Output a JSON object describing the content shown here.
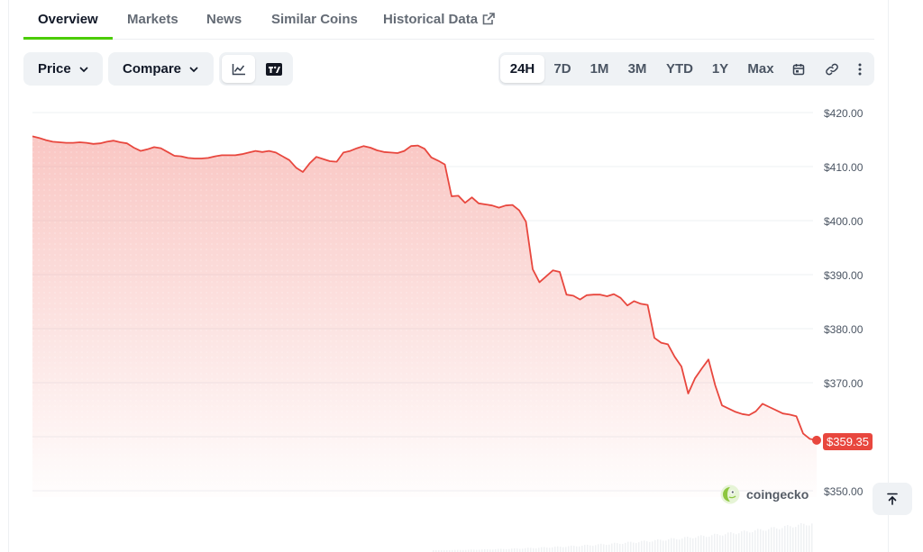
{
  "tabs": [
    {
      "label": "Overview",
      "active": true
    },
    {
      "label": "Markets"
    },
    {
      "label": "News"
    },
    {
      "label": "Similar Coins"
    },
    {
      "label": "Historical Data",
      "icon": "external-link-icon"
    }
  ],
  "toolbar": {
    "price_label": "Price",
    "compare_label": "Compare",
    "chart_types": [
      {
        "icon": "line-chart-icon",
        "selected": true
      },
      {
        "icon": "tradingview-icon",
        "selected": false
      }
    ],
    "ranges": [
      "24H",
      "7D",
      "1M",
      "3M",
      "YTD",
      "1Y",
      "Max"
    ],
    "selected_range": "24H",
    "extra_icons": [
      "calendar-icon",
      "link-icon",
      "more-vertical-icon"
    ]
  },
  "watermark": "coingecko",
  "colors": {
    "line": "#e8473e",
    "accent": "#4bcc00",
    "fill": "#f9c9c6"
  },
  "chart_data": {
    "type": "area",
    "ylim": [
      350,
      420
    ],
    "y_ticks": [
      "$350.00",
      "$360.00",
      "$370.00",
      "$380.00",
      "$390.00",
      "$400.00",
      "$410.00",
      "$420.00"
    ],
    "last_price_label": "$359.35",
    "last_value": 359.35,
    "values": [
      415.6,
      415.3,
      414.9,
      414.6,
      414.5,
      414.4,
      414.4,
      414.5,
      414.4,
      414.2,
      414.3,
      414.6,
      414.8,
      414.5,
      414.3,
      413.5,
      412.9,
      413.2,
      413.6,
      413.4,
      412.7,
      412.0,
      411.9,
      411.6,
      411.5,
      411.5,
      411.6,
      411.9,
      412.1,
      412.1,
      412.1,
      412.3,
      412.6,
      412.9,
      412.7,
      412.9,
      412.6,
      411.9,
      411.2,
      409.8,
      409.0,
      410.6,
      411.8,
      411.4,
      411.0,
      410.9,
      412.6,
      412.9,
      413.4,
      413.8,
      413.5,
      413.0,
      412.7,
      412.6,
      412.5,
      412.9,
      413.8,
      413.9,
      413.3,
      411.7,
      411.1,
      410.4,
      404.5,
      404.6,
      403.3,
      404.3,
      403.2,
      403.0,
      402.8,
      402.4,
      402.8,
      402.9,
      401.9,
      399.8,
      391.0,
      388.6,
      389.7,
      390.8,
      390.5,
      386.3,
      386.1,
      385.4,
      386.2,
      386.3,
      386.3,
      386.0,
      386.4,
      385.7,
      384.3,
      385.1,
      384.6,
      384.4,
      378.3,
      377.4,
      377.1,
      374.8,
      373.0,
      368.0,
      370.8,
      372.6,
      374.3,
      369.5,
      365.8,
      365.2,
      364.6,
      364.2,
      364.0,
      364.7,
      366.1,
      365.5,
      364.9,
      364.3,
      364.1,
      363.8,
      360.6,
      359.6,
      359.35
    ]
  }
}
